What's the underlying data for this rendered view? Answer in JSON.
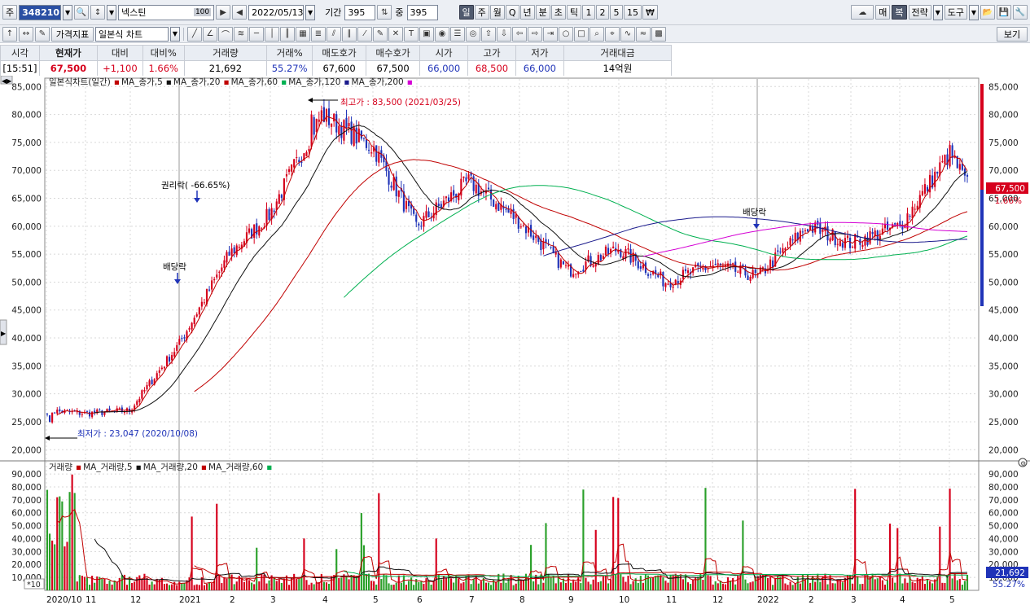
{
  "toolbar": {
    "prefix": "주",
    "stock_code": "348210",
    "stock_name": "넥스틴",
    "name_badge": "100",
    "date": "2022/05/13",
    "period_label": "기간",
    "period_value": "395",
    "overlap_label": "중",
    "overlap_value": "395",
    "timeframes": [
      "일",
      "주",
      "월",
      "Q",
      "년",
      "분",
      "초",
      "틱",
      "1",
      "2",
      "5",
      "15",
      "₩"
    ],
    "active_timeframe": "일",
    "right_buttons": [
      "매",
      "복",
      "전략",
      "도구"
    ]
  },
  "toolbar2": {
    "price_indicator": "가격지표",
    "chart_type": "일본식 차트",
    "view_button": "보기"
  },
  "quote": {
    "headers": [
      "시각",
      "현재가",
      "대비",
      "대비%",
      "거래량",
      "거래%",
      "매도호가",
      "매수호가",
      "시가",
      "고가",
      "저가",
      "거래대금"
    ],
    "values": [
      "[15:51]",
      "67,500",
      "+1,100",
      "1.66%",
      "21,692",
      "55.27%",
      "67,600",
      "67,500",
      "66,000",
      "68,500",
      "66,000",
      "14억원"
    ]
  },
  "price_legend": {
    "title": "일본식차트(일간)",
    "items": [
      {
        "name": "MA_종가,5",
        "color": "#c00000"
      },
      {
        "name": "MA_종가,20",
        "color": "#111111"
      },
      {
        "name": "MA_종가,60",
        "color": "#c00000"
      },
      {
        "name": "MA_종가,120",
        "color": "#00b050"
      },
      {
        "name": "MA_종가,200",
        "color": "#1a1a8c"
      },
      {
        "name": "",
        "color": "#d400d4"
      }
    ]
  },
  "volume_legend": {
    "title": "거래량",
    "items": [
      {
        "name": "MA_거래량,5",
        "color": "#c00000"
      },
      {
        "name": "MA_거래량,20",
        "color": "#111111"
      },
      {
        "name": "MA_거래량,60",
        "color": "#c00000"
      },
      {
        "name": "",
        "color": "#00b050"
      }
    ]
  },
  "annotations": {
    "high": "최고가 : 83,500 (2021/03/25)",
    "low": "최저가 : 23,047 (2020/10/08)",
    "rights": "권리락( -66.65%)",
    "dividend1": "배당락",
    "dividend2": "배당락"
  },
  "price_badge": {
    "price": "67,500",
    "pct": "1.66%"
  },
  "volume_badge": {
    "volume": "21,692",
    "pct": "55.27%"
  },
  "volume_unit": "*10",
  "colors": {
    "up": "#d6001c",
    "down": "#1f33b8",
    "ma5": "#c00000",
    "ma20": "#111111",
    "ma60": "#c00000",
    "ma120": "#00b050",
    "ma200": "#1a1a8c",
    "ma_extra": "#d400d4"
  },
  "chart_data": {
    "type": "candlestick",
    "price_axis": {
      "ticks": [
        20000,
        25000,
        30000,
        35000,
        40000,
        45000,
        50000,
        55000,
        60000,
        65000,
        70000,
        75000,
        80000,
        85000
      ],
      "range": [
        18000,
        86500
      ]
    },
    "volume_axis": {
      "ticks": [
        10000,
        20000,
        30000,
        40000,
        50000,
        60000,
        70000,
        80000,
        90000
      ],
      "range": [
        0,
        97000
      ]
    },
    "x_labels": [
      "2020/10",
      "11",
      "12",
      "2021",
      "2",
      "3",
      "4",
      "5",
      "6",
      "7",
      "8",
      "9",
      "10",
      "11",
      "12",
      "2022",
      "2",
      "3",
      "4",
      "5"
    ],
    "monthly_close": [
      {
        "month": "2020/10",
        "close": 26500
      },
      {
        "month": "11",
        "close": 27000
      },
      {
        "month": "12",
        "close": 39000
      },
      {
        "month": "2021",
        "close": 55000
      },
      {
        "month": "2",
        "close": 62000
      },
      {
        "month": "3",
        "close": 80000
      },
      {
        "month": "4",
        "close": 74000
      },
      {
        "month": "5",
        "close": 60000
      },
      {
        "month": "6",
        "close": 68000
      },
      {
        "month": "7",
        "close": 61000
      },
      {
        "month": "8",
        "close": 52000
      },
      {
        "month": "9",
        "close": 56000
      },
      {
        "month": "10",
        "close": 50000
      },
      {
        "month": "11",
        "close": 53000
      },
      {
        "month": "12",
        "close": 51000
      },
      {
        "month": "2022",
        "close": 60000
      },
      {
        "month": "2",
        "close": 57000
      },
      {
        "month": "3",
        "close": 60000
      },
      {
        "month": "4",
        "close": 73000
      },
      {
        "month": "5",
        "close": 67500
      }
    ],
    "high": {
      "value": 83500,
      "date": "2021/03/25"
    },
    "low": {
      "value": 23047,
      "date": "2020/10/08"
    },
    "last": 67500
  }
}
